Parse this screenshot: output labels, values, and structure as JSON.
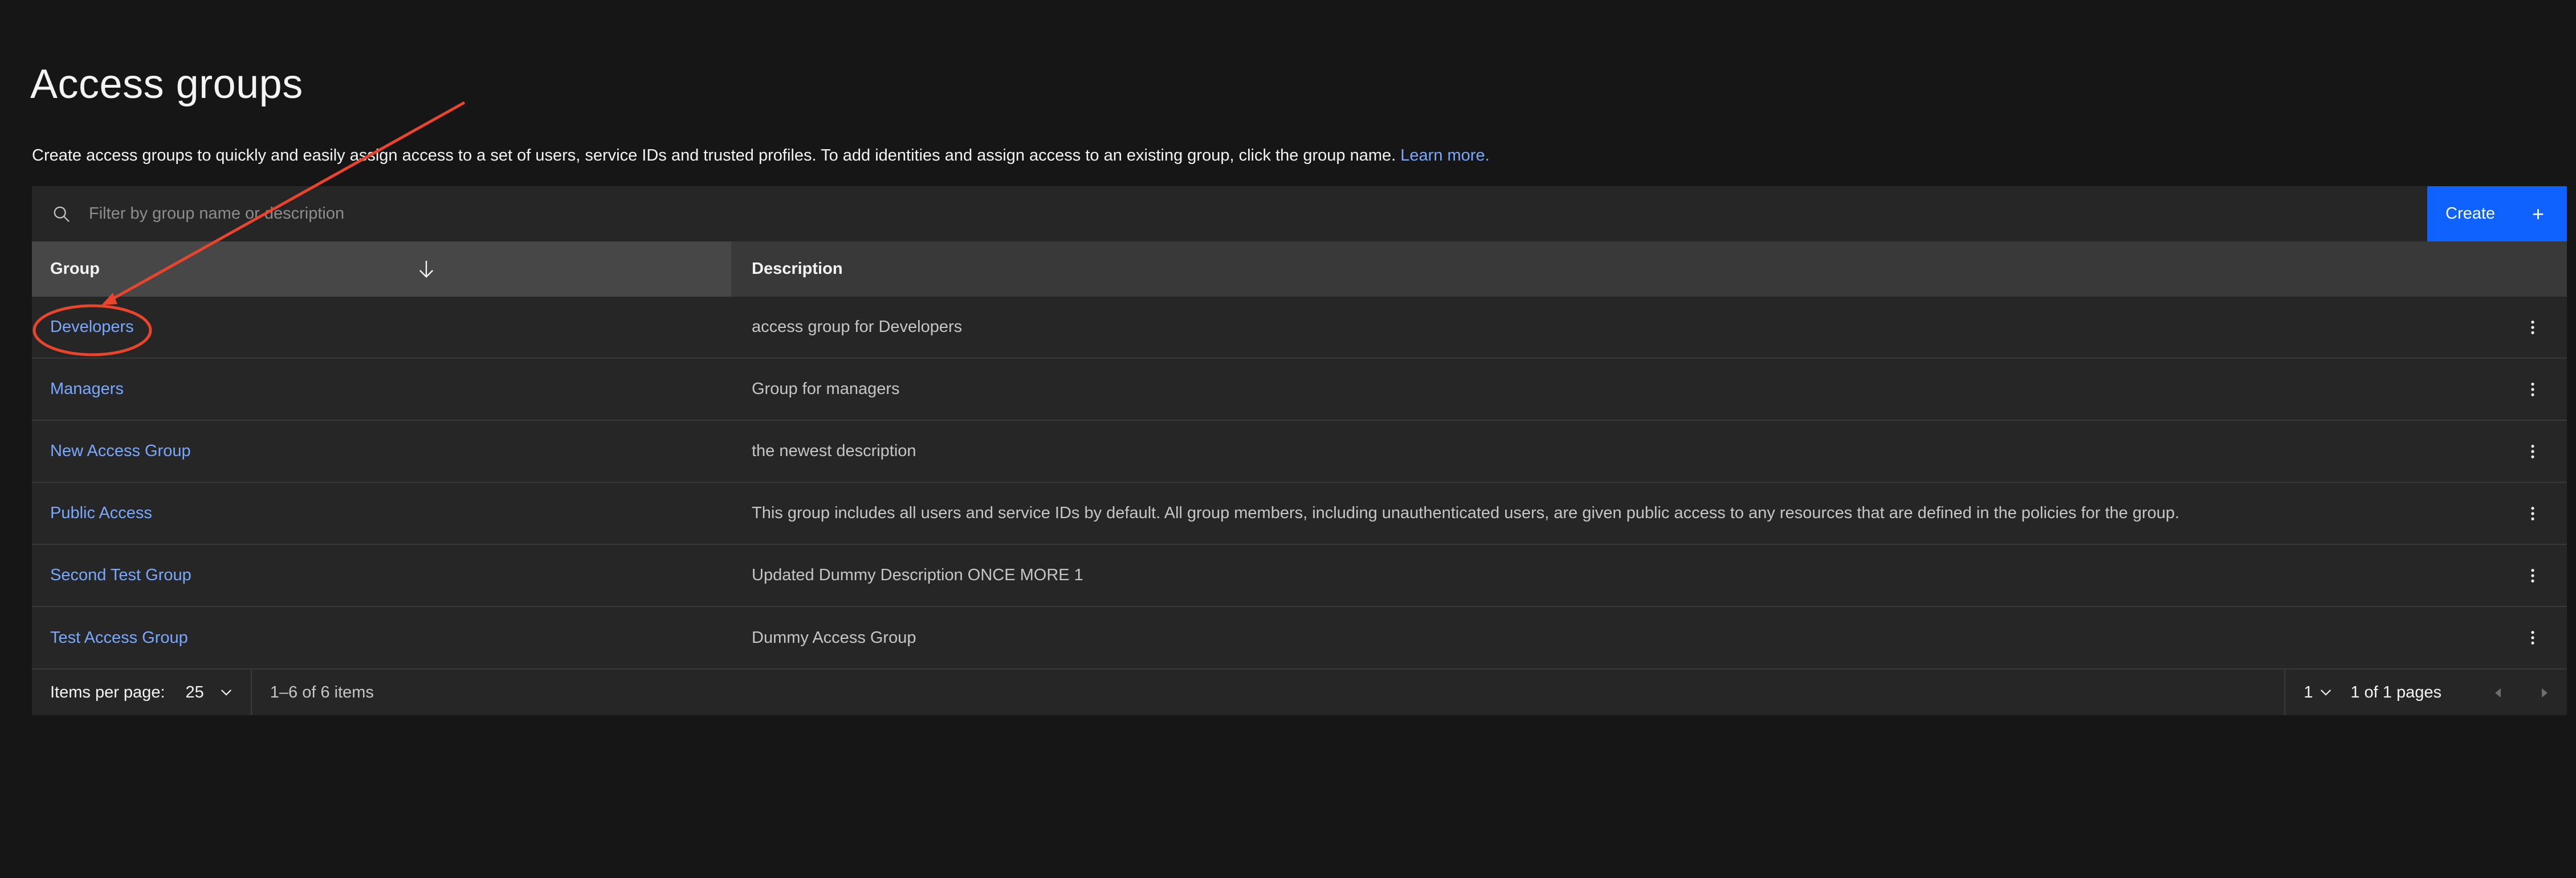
{
  "header": {
    "title": "Access groups",
    "description": "Create access groups to quickly and easily assign access to a set of users, service IDs and trusted profiles. To add identities and assign access to an existing group, click the group name.",
    "learn_more": "Learn more."
  },
  "toolbar": {
    "search_placeholder": "Filter by group name or description",
    "create_label": "Create",
    "create_icon": "+"
  },
  "table": {
    "columns": {
      "group": "Group",
      "description": "Description"
    },
    "rows": [
      {
        "group": "Developers",
        "description": "access group for Developers"
      },
      {
        "group": "Managers",
        "description": "Group for managers"
      },
      {
        "group": "New Access Group",
        "description": "the newest description"
      },
      {
        "group": "Public Access",
        "description": "This group includes all users and service IDs by default. All group members, including unauthenticated users, are given public access to any resources that are defined in the policies for the group."
      },
      {
        "group": "Second Test Group",
        "description": "Updated Dummy Description ONCE MORE 1"
      },
      {
        "group": "Test Access Group",
        "description": "Dummy Access Group"
      }
    ]
  },
  "pagination": {
    "items_per_page_label": "Items per page:",
    "items_per_page_value": "25",
    "range_text": "1–6 of 6 items",
    "current_page": "1",
    "pages_text": "1 of 1 pages"
  },
  "colors": {
    "background": "#161616",
    "surface": "#262626",
    "header": "#393939",
    "link": "#78a9ff",
    "primary": "#0f62fe",
    "annotation": "#e8452c"
  },
  "icons": {
    "search": "search-icon",
    "sort": "arrow-down-icon",
    "overflow": "overflow-menu-vertical-icon",
    "chevron": "chevron-down-icon",
    "prev": "caret-left-icon",
    "next": "caret-right-icon"
  }
}
